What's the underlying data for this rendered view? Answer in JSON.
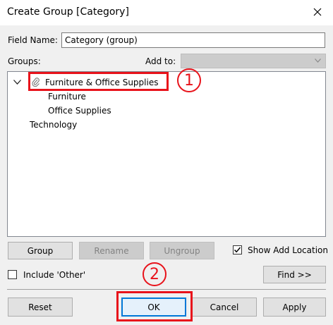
{
  "window": {
    "title": "Create Group [Category]"
  },
  "field_name": {
    "label": "Field Name:",
    "value": "Category (group)"
  },
  "groups_label": "Groups:",
  "add_to": {
    "label": "Add to:",
    "value": ""
  },
  "tree": {
    "group": {
      "label": "Furniture & Office Supplies",
      "children": [
        "Furniture",
        "Office Supplies"
      ]
    },
    "items": [
      "Technology"
    ]
  },
  "buttons": {
    "group": "Group",
    "rename": "Rename",
    "ungroup": "Ungroup",
    "find": "Find >>",
    "reset": "Reset",
    "ok": "OK",
    "cancel": "Cancel",
    "apply": "Apply"
  },
  "show_add_location": {
    "label": "Show Add Location",
    "checked": true
  },
  "include_other": {
    "label": "Include 'Other'",
    "checked": false
  },
  "annotations": {
    "step1": "1",
    "step2": "2"
  },
  "colors": {
    "annotation_red": "#e8131b",
    "focus_blue": "#0078d7"
  }
}
